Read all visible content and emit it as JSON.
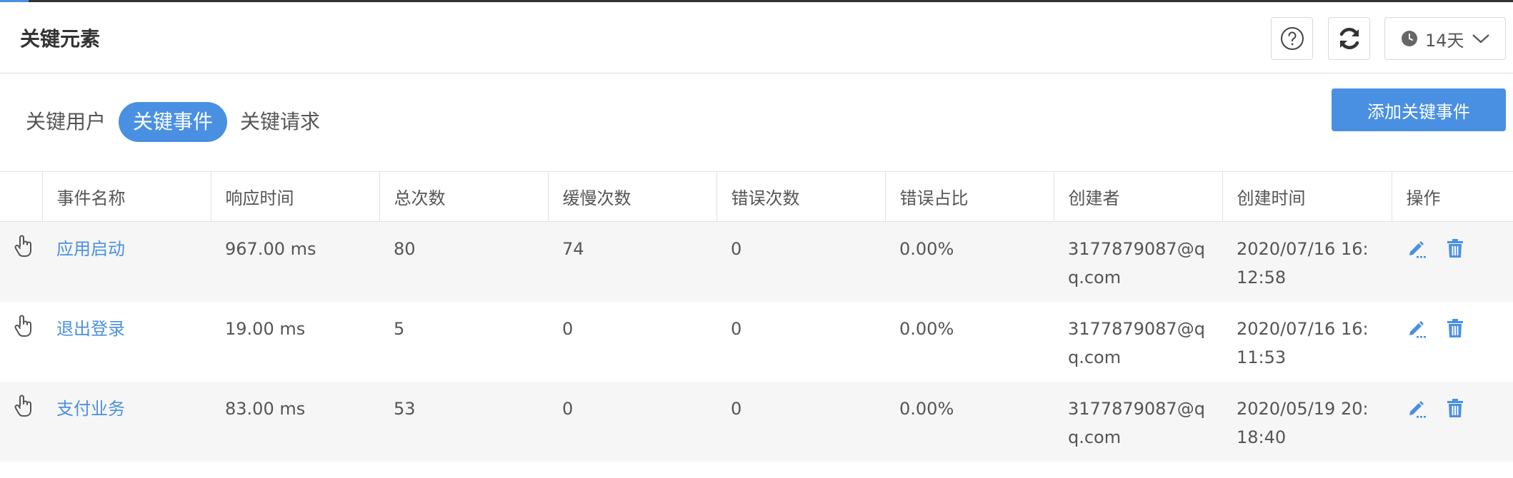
{
  "header": {
    "title": "关键元素",
    "time_range": "14天"
  },
  "tabs": [
    {
      "label": "关键用户",
      "active": false
    },
    {
      "label": "关键事件",
      "active": true
    },
    {
      "label": "关键请求",
      "active": false
    }
  ],
  "actions": {
    "add_label": "添加关键事件"
  },
  "colors": {
    "accent": "#4a90e2",
    "row_alt": "#f7f6f6"
  },
  "table": {
    "columns": [
      "",
      "事件名称",
      "响应时间",
      "总次数",
      "缓慢次数",
      "错误次数",
      "错误占比",
      "创建者",
      "创建时间",
      "操作"
    ],
    "rows": [
      {
        "name": "应用启动",
        "response": "967.00 ms",
        "total": "80",
        "slow": "74",
        "errors": "0",
        "error_ratio": "0.00%",
        "creator": "3177879087@qq.com",
        "created": "2020/07/16 16:12:58"
      },
      {
        "name": "退出登录",
        "response": "19.00 ms",
        "total": "5",
        "slow": "0",
        "errors": "0",
        "error_ratio": "0.00%",
        "creator": "3177879087@qq.com",
        "created": "2020/07/16 16:11:53"
      },
      {
        "name": "支付业务",
        "response": "83.00 ms",
        "total": "53",
        "slow": "0",
        "errors": "0",
        "error_ratio": "0.00%",
        "creator": "3177879087@qq.com",
        "created": "2020/05/19 20:18:40"
      }
    ],
    "row_icons": [
      "hand-pointer-icon",
      "edit-icon",
      "trash-icon"
    ]
  }
}
